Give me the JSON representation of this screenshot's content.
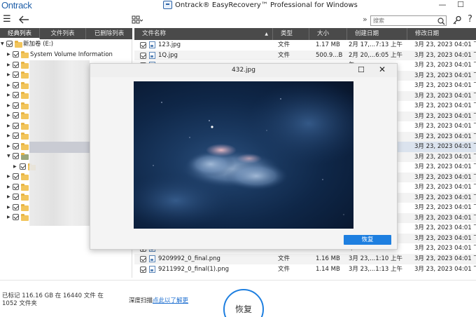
{
  "app": {
    "logo": "Ontrack",
    "title": "Ontrack® EasyRecovery™ Professional for Windows"
  },
  "toolbar": {
    "search_placeholder": "搜索"
  },
  "left_panel": {
    "tabs": [
      "经典列表",
      "文件列表",
      "已删除列表"
    ],
    "tree": [
      {
        "label": "新加卷 (E:)",
        "level": 0
      },
      {
        "label": "System Volume Information",
        "level": 1
      }
    ]
  },
  "file_list": {
    "columns": [
      "文件名称",
      "类型",
      "大小",
      "创建日期",
      "修改日期"
    ],
    "rows": [
      {
        "name": "123.jpg",
        "type": "文件",
        "size": "1.17 MB",
        "created": "2月 17,...7:13 上午",
        "modified": "3月 23, 2023 04:01 下午"
      },
      {
        "name": "1Q.jpg",
        "type": "文件",
        "size": "500.9...B",
        "created": "2月 20,...6:05 上午",
        "modified": "3月 23, 2023 04:01 下午"
      },
      {
        "name": "",
        "type": "",
        "size": "",
        "created": "午",
        "modified": "3月 23, 2023 04:01 下午"
      },
      {
        "name": "",
        "type": "",
        "size": "",
        "created": "午",
        "modified": "3月 23, 2023 04:01 下午"
      },
      {
        "name": "",
        "type": "",
        "size": "",
        "created": "午",
        "modified": "3月 23, 2023 04:01 下午"
      },
      {
        "name": "",
        "type": "",
        "size": "",
        "created": "午",
        "modified": "3月 23, 2023 04:01 下午"
      },
      {
        "name": "",
        "type": "",
        "size": "",
        "created": "午",
        "modified": "3月 23, 2023 04:01 下午"
      },
      {
        "name": "",
        "type": "",
        "size": "",
        "created": "午",
        "modified": "3月 23, 2023 04:01 下午"
      },
      {
        "name": "",
        "type": "",
        "size": "",
        "created": "午",
        "modified": "3月 23, 2023 04:01 下午"
      },
      {
        "name": "",
        "type": "",
        "size": "",
        "created": "午",
        "modified": "3月 23, 2023 04:01 下午"
      },
      {
        "name": "",
        "type": "",
        "size": "",
        "created": "午",
        "modified": "3月 23, 2023 04:01 下午"
      },
      {
        "name": "",
        "type": "",
        "size": "",
        "created": "午",
        "modified": "3月 23, 2023 04:01 下午"
      },
      {
        "name": "",
        "type": "",
        "size": "",
        "created": "午",
        "modified": "3月 23, 2023 04:01 下午"
      },
      {
        "name": "",
        "type": "",
        "size": "",
        "created": "午",
        "modified": "3月 23, 2023 04:01 下午"
      },
      {
        "name": "",
        "type": "",
        "size": "",
        "created": "午",
        "modified": "3月 23, 2023 04:01 下午"
      },
      {
        "name": "",
        "type": "",
        "size": "",
        "created": "午",
        "modified": "3月 23, 2023 04:01 下午"
      },
      {
        "name": "",
        "type": "",
        "size": "",
        "created": "午",
        "modified": "3月 23, 2023 04:01 下午"
      },
      {
        "name": "",
        "type": "",
        "size": "",
        "created": "午",
        "modified": "3月 23, 2023 04:01 下午"
      },
      {
        "name": "",
        "type": "",
        "size": "",
        "created": "午",
        "modified": "3月 23, 2023 04:01 下午"
      },
      {
        "name": "",
        "type": "",
        "size": "",
        "created": "午",
        "modified": "3月 23, 2023 04:01 下午"
      },
      {
        "name": "",
        "type": "",
        "size": "",
        "created": "午",
        "modified": "3月 23, 2023 04:01 下午"
      },
      {
        "name": "9209992_0_final.png",
        "type": "文件",
        "size": "1.16 MB",
        "created": "3月 23,...1:10 上午",
        "modified": "3月 23, 2023 04:01 下午"
      },
      {
        "name": "9211992_0_final(1).png",
        "type": "文件",
        "size": "1.14 MB",
        "created": "3月 23,...1:13 上午",
        "modified": "3月 23, 2023 04:01 下午"
      }
    ]
  },
  "dialog": {
    "title": "432.jpg",
    "recover_label": "恢复"
  },
  "status": {
    "summary_line1": "已标记 116.16 GB 在 16440 文件 在",
    "summary_line2": "1052 文件夹",
    "deep_scan_label": "深度扫描",
    "deep_scan_link": "点此以了解更",
    "recover_label": "恢复"
  },
  "colors": {
    "accent": "#1e7fe0",
    "header_bg": "#4a4a4a",
    "logo": "#1f5fa8"
  }
}
